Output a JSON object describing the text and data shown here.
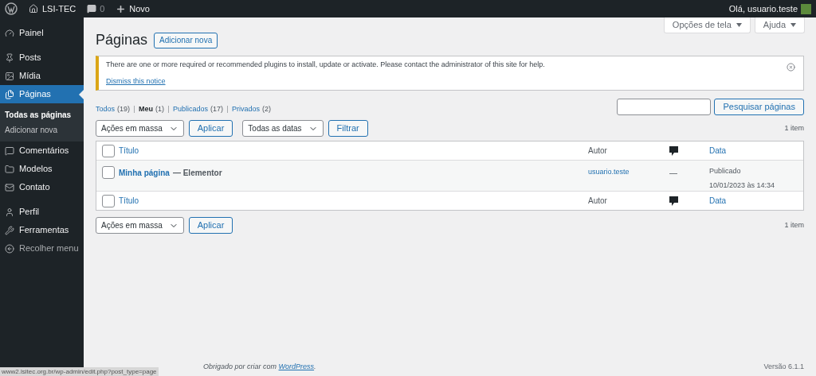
{
  "admin_bar": {
    "site": "LSI-TEC",
    "comments": "0",
    "new": "Novo",
    "greeting": "Olá, usuario.teste"
  },
  "sidebar": {
    "items": [
      {
        "label": "Painel",
        "selected": false
      },
      {
        "label": "Posts",
        "selected": false
      },
      {
        "label": "Mídia",
        "selected": false
      },
      {
        "label": "Páginas",
        "selected": true,
        "children": [
          {
            "label": "Todas as páginas",
            "selected": true
          },
          {
            "label": "Adicionar nova",
            "selected": false
          }
        ]
      },
      {
        "label": "Comentários",
        "selected": false
      },
      {
        "label": "Modelos",
        "selected": false
      },
      {
        "label": "Contato",
        "selected": false
      },
      {
        "label": "Perfil",
        "selected": false
      },
      {
        "label": "Ferramentas",
        "selected": false
      },
      {
        "label": "Recolher menu",
        "selected": false
      }
    ]
  },
  "screen_buttons": [
    "Opções de tela",
    "Ajuda"
  ],
  "title": "Páginas",
  "add_new": "Adicionar nova",
  "notice": {
    "text": "There are one or more required or recommended plugins to install, update or activate. Please contact the administrator of this site for help.",
    "dismiss": "Dismiss this notice"
  },
  "filters": [
    {
      "label": "Todos",
      "count": "(19)",
      "selected": false
    },
    {
      "label": "Meu",
      "count": "(1)",
      "selected": true
    },
    {
      "label": "Publicados",
      "count": "(17)",
      "selected": false
    },
    {
      "label": "Privados",
      "count": "(2)",
      "selected": false
    }
  ],
  "search": {
    "button": "Pesquisar páginas"
  },
  "top_actions": {
    "bulk": "Ações em massa",
    "apply": "Aplicar",
    "dates": "Todas as datas",
    "filter": "Filtrar",
    "count": "1 item"
  },
  "table": {
    "columns": [
      "Título",
      "Autor",
      "Data"
    ],
    "footer_columns": [
      "Título",
      "Autor",
      "Data"
    ],
    "rows": [
      {
        "title": "Minha página",
        "suffix": "— Elementor",
        "author": "usuario.teste",
        "comments": "—",
        "status": "Publicado",
        "date": "10/01/2023 às 14:34",
        "checked": false
      }
    ],
    "header_checked": false,
    "footer_checked": false
  },
  "bottom_actions": {
    "bulk": "Ações em massa",
    "apply": "Aplicar",
    "count": "1 item"
  },
  "footer": {
    "thanks": "Obrigado por criar com",
    "link": "WordPress",
    "period": ".",
    "version": "Versão 6.1.1"
  },
  "status_url": "www2.lsitec.org.br/wp-admin/edit.php?post_type=page"
}
